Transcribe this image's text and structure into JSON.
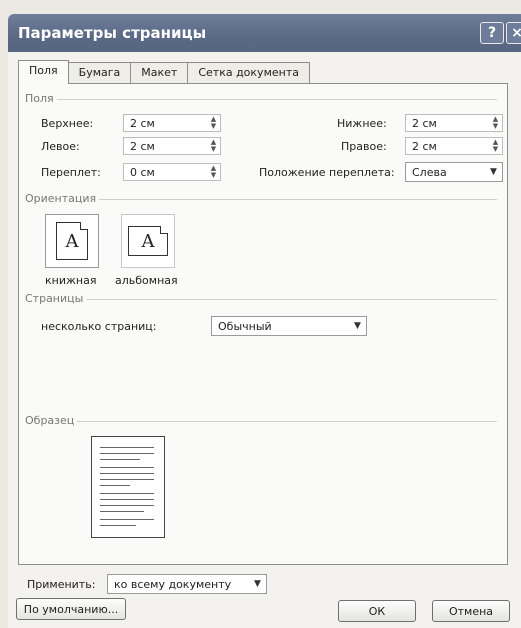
{
  "window": {
    "title": "Параметры страницы",
    "help": "?",
    "close": "×"
  },
  "tabs": [
    "Поля",
    "Бумага",
    "Макет",
    "Сетка документа"
  ],
  "margins": {
    "group": "Поля",
    "top_label": "Верхнее:",
    "top_value": "2 см",
    "bottom_label": "Нижнее:",
    "bottom_value": "2 см",
    "left_label": "Левое:",
    "left_value": "2 см",
    "right_label": "Правое:",
    "right_value": "2 см",
    "gutter_label": "Переплет:",
    "gutter_value": "0 см",
    "gutter_pos_label": "Положение переплета:",
    "gutter_pos_value": "Слева"
  },
  "orientation": {
    "group": "Ориентация",
    "portrait_label": "книжная",
    "landscape_label": "альбомная",
    "glyph": "A"
  },
  "pages": {
    "group": "Страницы",
    "multiple_label": "несколько страниц:",
    "multiple_value": "Обычный"
  },
  "preview": {
    "group": "Образец",
    "apply_label": "Применить:",
    "apply_value": "ко всему документу"
  },
  "buttons": {
    "default": "По умолчанию...",
    "ok": "ОК",
    "cancel": "Отмена"
  }
}
